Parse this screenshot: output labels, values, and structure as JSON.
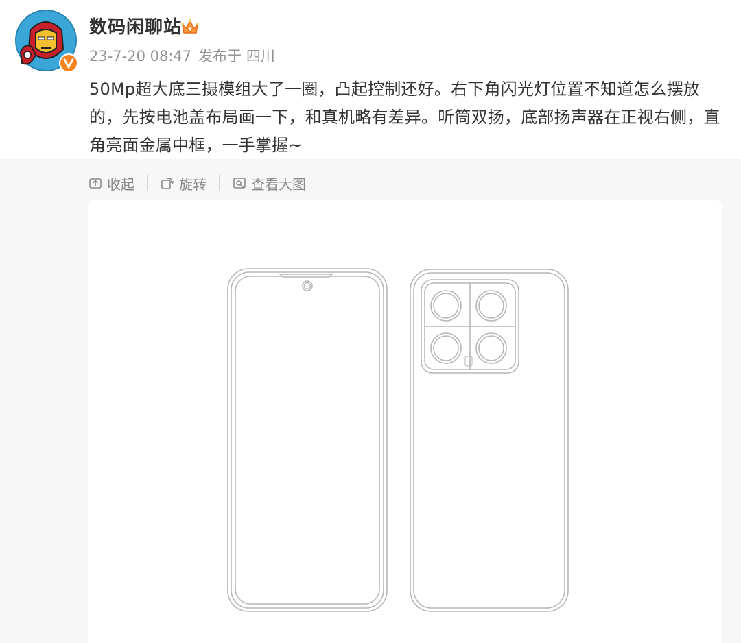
{
  "author": {
    "name": "数码闲聊站",
    "verified": true
  },
  "meta": {
    "time": "23-7-20 08:47",
    "location": "发布于 四川"
  },
  "post": {
    "text": "50Mp超大底三摄模组大了一圈，凸起控制还好。右下角闪光灯位置不知道怎么摆放的，先按电池盖布局画一下，和真机略有差异。听筒双扬，底部扬声器在正视右侧，直角亮面金属中框，一手掌握~"
  },
  "toolbar": {
    "collapse": "收起",
    "rotate": "旋转",
    "view_large": "查看大图"
  },
  "colors": {
    "text": "#333333",
    "meta": "#939393",
    "media_bg": "#f7f7f7",
    "verified_badge": "#f58220"
  }
}
